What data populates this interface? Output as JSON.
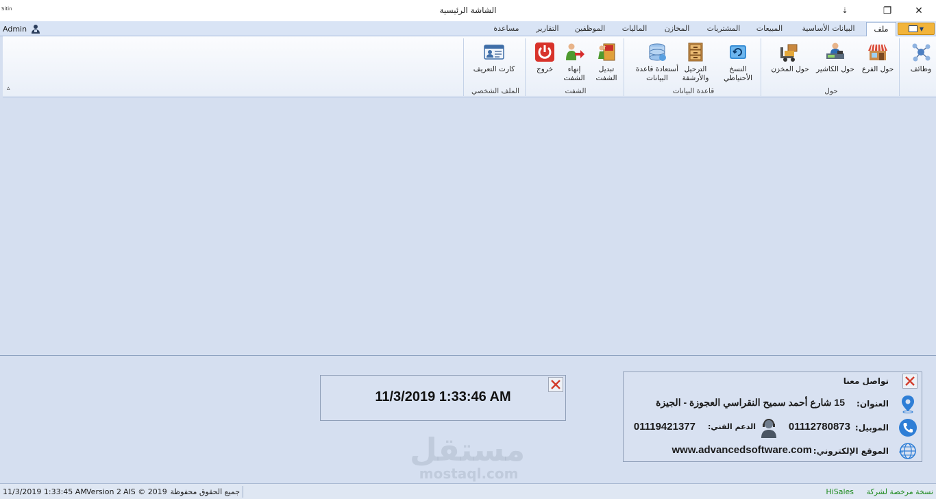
{
  "window": {
    "logo_text": "Sitin",
    "title": "الشاشة الرئيسية",
    "menu_glyph": "⇣",
    "restore_glyph": "❐",
    "close_glyph": "✕"
  },
  "user": {
    "name": "Admin"
  },
  "tabs": [
    {
      "label": "ملف",
      "active": true
    },
    {
      "label": "البيانات الأساسية"
    },
    {
      "label": "المبيعات"
    },
    {
      "label": "المشتريات"
    },
    {
      "label": "المخازن"
    },
    {
      "label": "الماليات"
    },
    {
      "label": "الموظفين"
    },
    {
      "label": "التقارير"
    },
    {
      "label": "مساعدة"
    }
  ],
  "ribbon": {
    "items": {
      "functions": "وظائف",
      "about_branch": "حول الفرع",
      "about_cashier": "حول الكاشير",
      "about_store": "حول المخزن",
      "backup": "النسخ\nالأحتياطي",
      "archive": "الترحيل\nوالأرشفة",
      "restore_db": "أستعادة قاعدة\nالبيانات",
      "change_shift": "تبديل\nالشفت",
      "end_shift": "إنهاء\nالشفت",
      "exit": "خروج",
      "id_card": "كارت التعريف"
    },
    "groups": {
      "about": "حول",
      "database": "قاعدة البيانات",
      "shift": "الشفت",
      "profile": "الملف الشخصي"
    },
    "collapse_glyph": "▵"
  },
  "clock": {
    "datetime": "11/3/2019 1:33:46 AM"
  },
  "contact": {
    "title": "تواصل معنا",
    "address_label": "العنوان:",
    "address_value": "15 شارع أحمد سميح النقراسي العجوزة - الجيزة",
    "mobile_label": "الموبيل:",
    "mobile_value": "01112780873",
    "support_label": "الدعم الفني:",
    "support_value": "01119421377",
    "website_label": "الموقع الإلكتروني:",
    "website_value": "www.advancedsoftware.com"
  },
  "watermark": {
    "arabic": "مستقل",
    "latin": "mostaql.com"
  },
  "status": {
    "license": "نسخة مرخصة لشركة",
    "company": "HiSales",
    "rights": "جميع الحقوق محفوظة",
    "copyright": "AIS © 2019",
    "version": "Version 2",
    "timestamp": "11/3/2019 1:33:45 AM"
  },
  "colors": {
    "background": "#d5dff0",
    "accent_orange": "#f2b43a",
    "close_red": "#d23b2a",
    "license_green": "#1f8a1f"
  }
}
